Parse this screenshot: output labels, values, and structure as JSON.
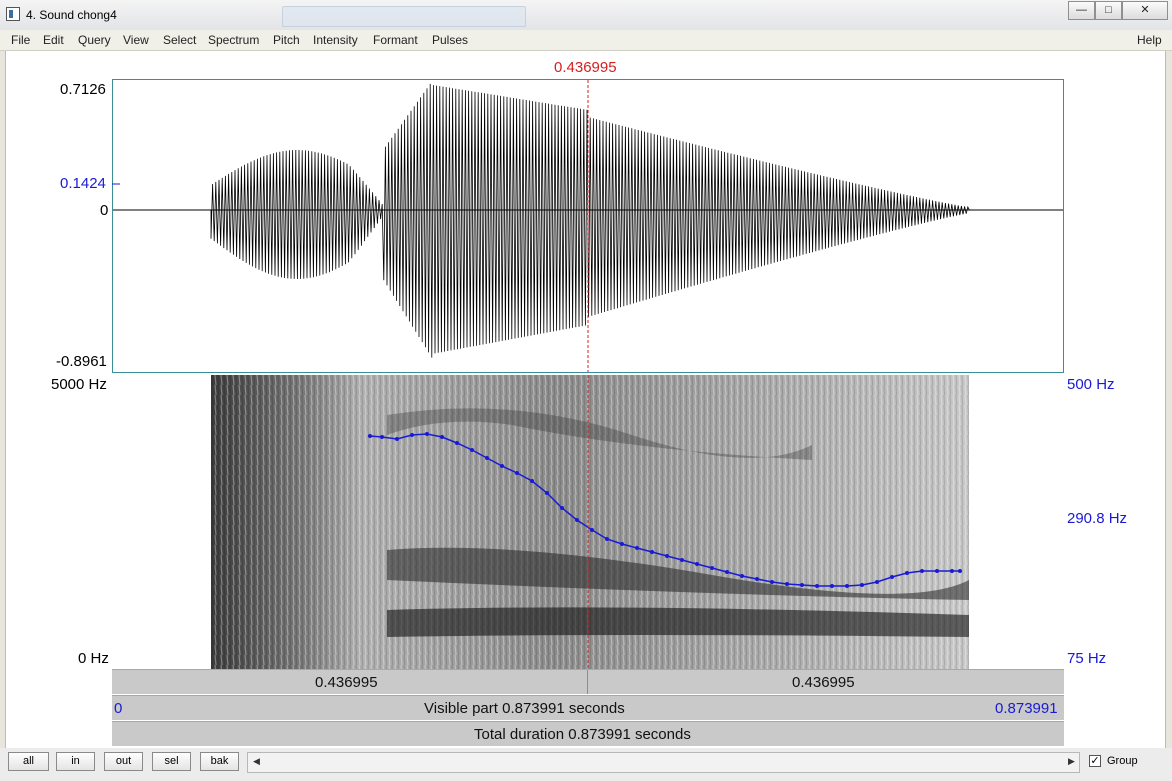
{
  "window": {
    "title": "4. Sound chong4",
    "minimize_label": "—",
    "maximize_label": "□",
    "close_label": "✕"
  },
  "menu": {
    "items": [
      "File",
      "Edit",
      "Query",
      "View",
      "Select",
      "Spectrum",
      "Pitch",
      "Intensity",
      "Formant",
      "Pulses"
    ],
    "help": "Help"
  },
  "cursor_time": "0.436995",
  "waveform": {
    "y_max": "0.7126",
    "y_mid": "0.1424",
    "y_zero": "0",
    "y_min": "-0.8961"
  },
  "spectrogram": {
    "freq_top": "5000 Hz",
    "freq_bottom": "0 Hz"
  },
  "pitch_axis": {
    "top": "500 Hz",
    "mid": "290.8 Hz",
    "bottom": "75 Hz"
  },
  "time_bars": {
    "left_segment": "0.436995",
    "right_segment": "0.436995",
    "visible_start": "0",
    "visible_label": "Visible part 0.873991 seconds",
    "visible_end": "0.873991",
    "total_label": "Total duration 0.873991 seconds"
  },
  "toolbar": {
    "all": "all",
    "in": "in",
    "out": "out",
    "sel": "sel",
    "bak": "bak",
    "group_label": "Group",
    "group_checked": "✓"
  },
  "colors": {
    "cursor": "#d42020",
    "pitch_curve": "#1a1ad6",
    "axis_blue": "#1a1ad6"
  }
}
